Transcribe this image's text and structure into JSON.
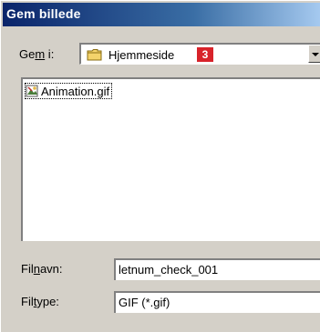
{
  "window": {
    "title": "Gem billede"
  },
  "location": {
    "label_prefix": "Ge",
    "label_mnemonic": "m",
    "label_suffix": " i:",
    "folder": "Hjemmeside",
    "badge": "3"
  },
  "files": [
    {
      "name": "Animation.gif"
    }
  ],
  "filename": {
    "label_prefix": "Fil",
    "label_mnemonic": "n",
    "label_suffix": "avn:",
    "value": "letnum_check_001"
  },
  "filetype": {
    "label_prefix": "Fil",
    "label_mnemonic": "t",
    "label_suffix": "ype:",
    "value": "GIF (*.gif)"
  }
}
